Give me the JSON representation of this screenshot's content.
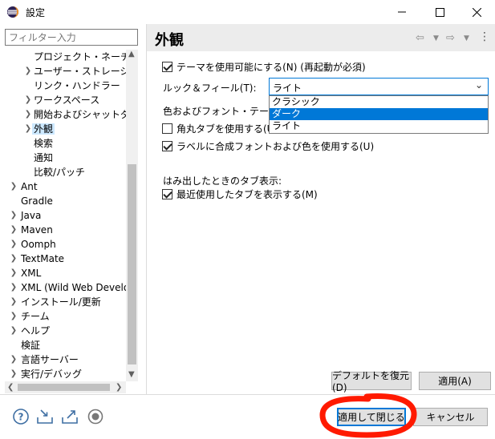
{
  "window": {
    "title": "設定"
  },
  "filter": {
    "placeholder": "フィルター入力"
  },
  "tree": {
    "items": [
      {
        "label": "プロジェクト・ネーチャー",
        "has_children": false
      },
      {
        "label": "ユーザー・ストレージ・サー",
        "has_children": true
      },
      {
        "label": "リンク・ハンドラー",
        "has_children": false
      },
      {
        "label": "ワークスペース",
        "has_children": true
      },
      {
        "label": "開始およびシャットダウン",
        "has_children": true
      },
      {
        "label": "外観",
        "has_children": true,
        "selected": true
      },
      {
        "label": "検索",
        "has_children": false
      },
      {
        "label": "通知",
        "has_children": false
      },
      {
        "label": "比較/パッチ",
        "has_children": false
      },
      {
        "label": "Ant",
        "has_children": true
      },
      {
        "label": "Gradle",
        "has_children": false
      },
      {
        "label": "Java",
        "has_children": true
      },
      {
        "label": "Maven",
        "has_children": true
      },
      {
        "label": "Oomph",
        "has_children": true
      },
      {
        "label": "TextMate",
        "has_children": true
      },
      {
        "label": "XML",
        "has_children": true
      },
      {
        "label": "XML (Wild Web Develop",
        "has_children": true
      },
      {
        "label": "インストール/更新",
        "has_children": true
      },
      {
        "label": "チーム",
        "has_children": true
      },
      {
        "label": "ヘルプ",
        "has_children": true
      },
      {
        "label": "検証",
        "has_children": false
      },
      {
        "label": "言語サーバー",
        "has_children": true
      },
      {
        "label": "実行/デバッグ",
        "has_children": true
      }
    ]
  },
  "page": {
    "title": "外観",
    "enable_themes": {
      "label": "テーマを使用可能にする(N) (再起動が必須)",
      "checked": true
    },
    "look_and_feel": {
      "label": "ルック＆フィール(T):",
      "value": "ライト",
      "options": [
        "クラシック",
        "ダーク",
        "ライト"
      ],
      "highlighted": "ダーク"
    },
    "color_font_theme_label": "色およびフォント・テーマ(C):",
    "rounded_tabs": {
      "label": "角丸タブを使用する(U)",
      "checked": false
    },
    "mixed_fonts": {
      "label": "ラベルに合成フォントおよび色を使用する(U)",
      "checked": true
    },
    "tab_overflow_heading": "はみ出したときのタブ表示:",
    "recent_tabs": {
      "label": "最近使用したタブを表示する(M)",
      "checked": true
    }
  },
  "buttons": {
    "restore_defaults": "デフォルトを復元(D)",
    "apply": "適用(A)",
    "apply_and_close": "適用して閉じる",
    "cancel": "キャンセル"
  },
  "colors": {
    "accent": "#0078d7",
    "selection": "#cce8ff",
    "annotation": "#ff1a00"
  },
  "icons": {
    "help": "help-icon",
    "import": "import-icon",
    "export": "export-icon",
    "record": "record-icon"
  }
}
